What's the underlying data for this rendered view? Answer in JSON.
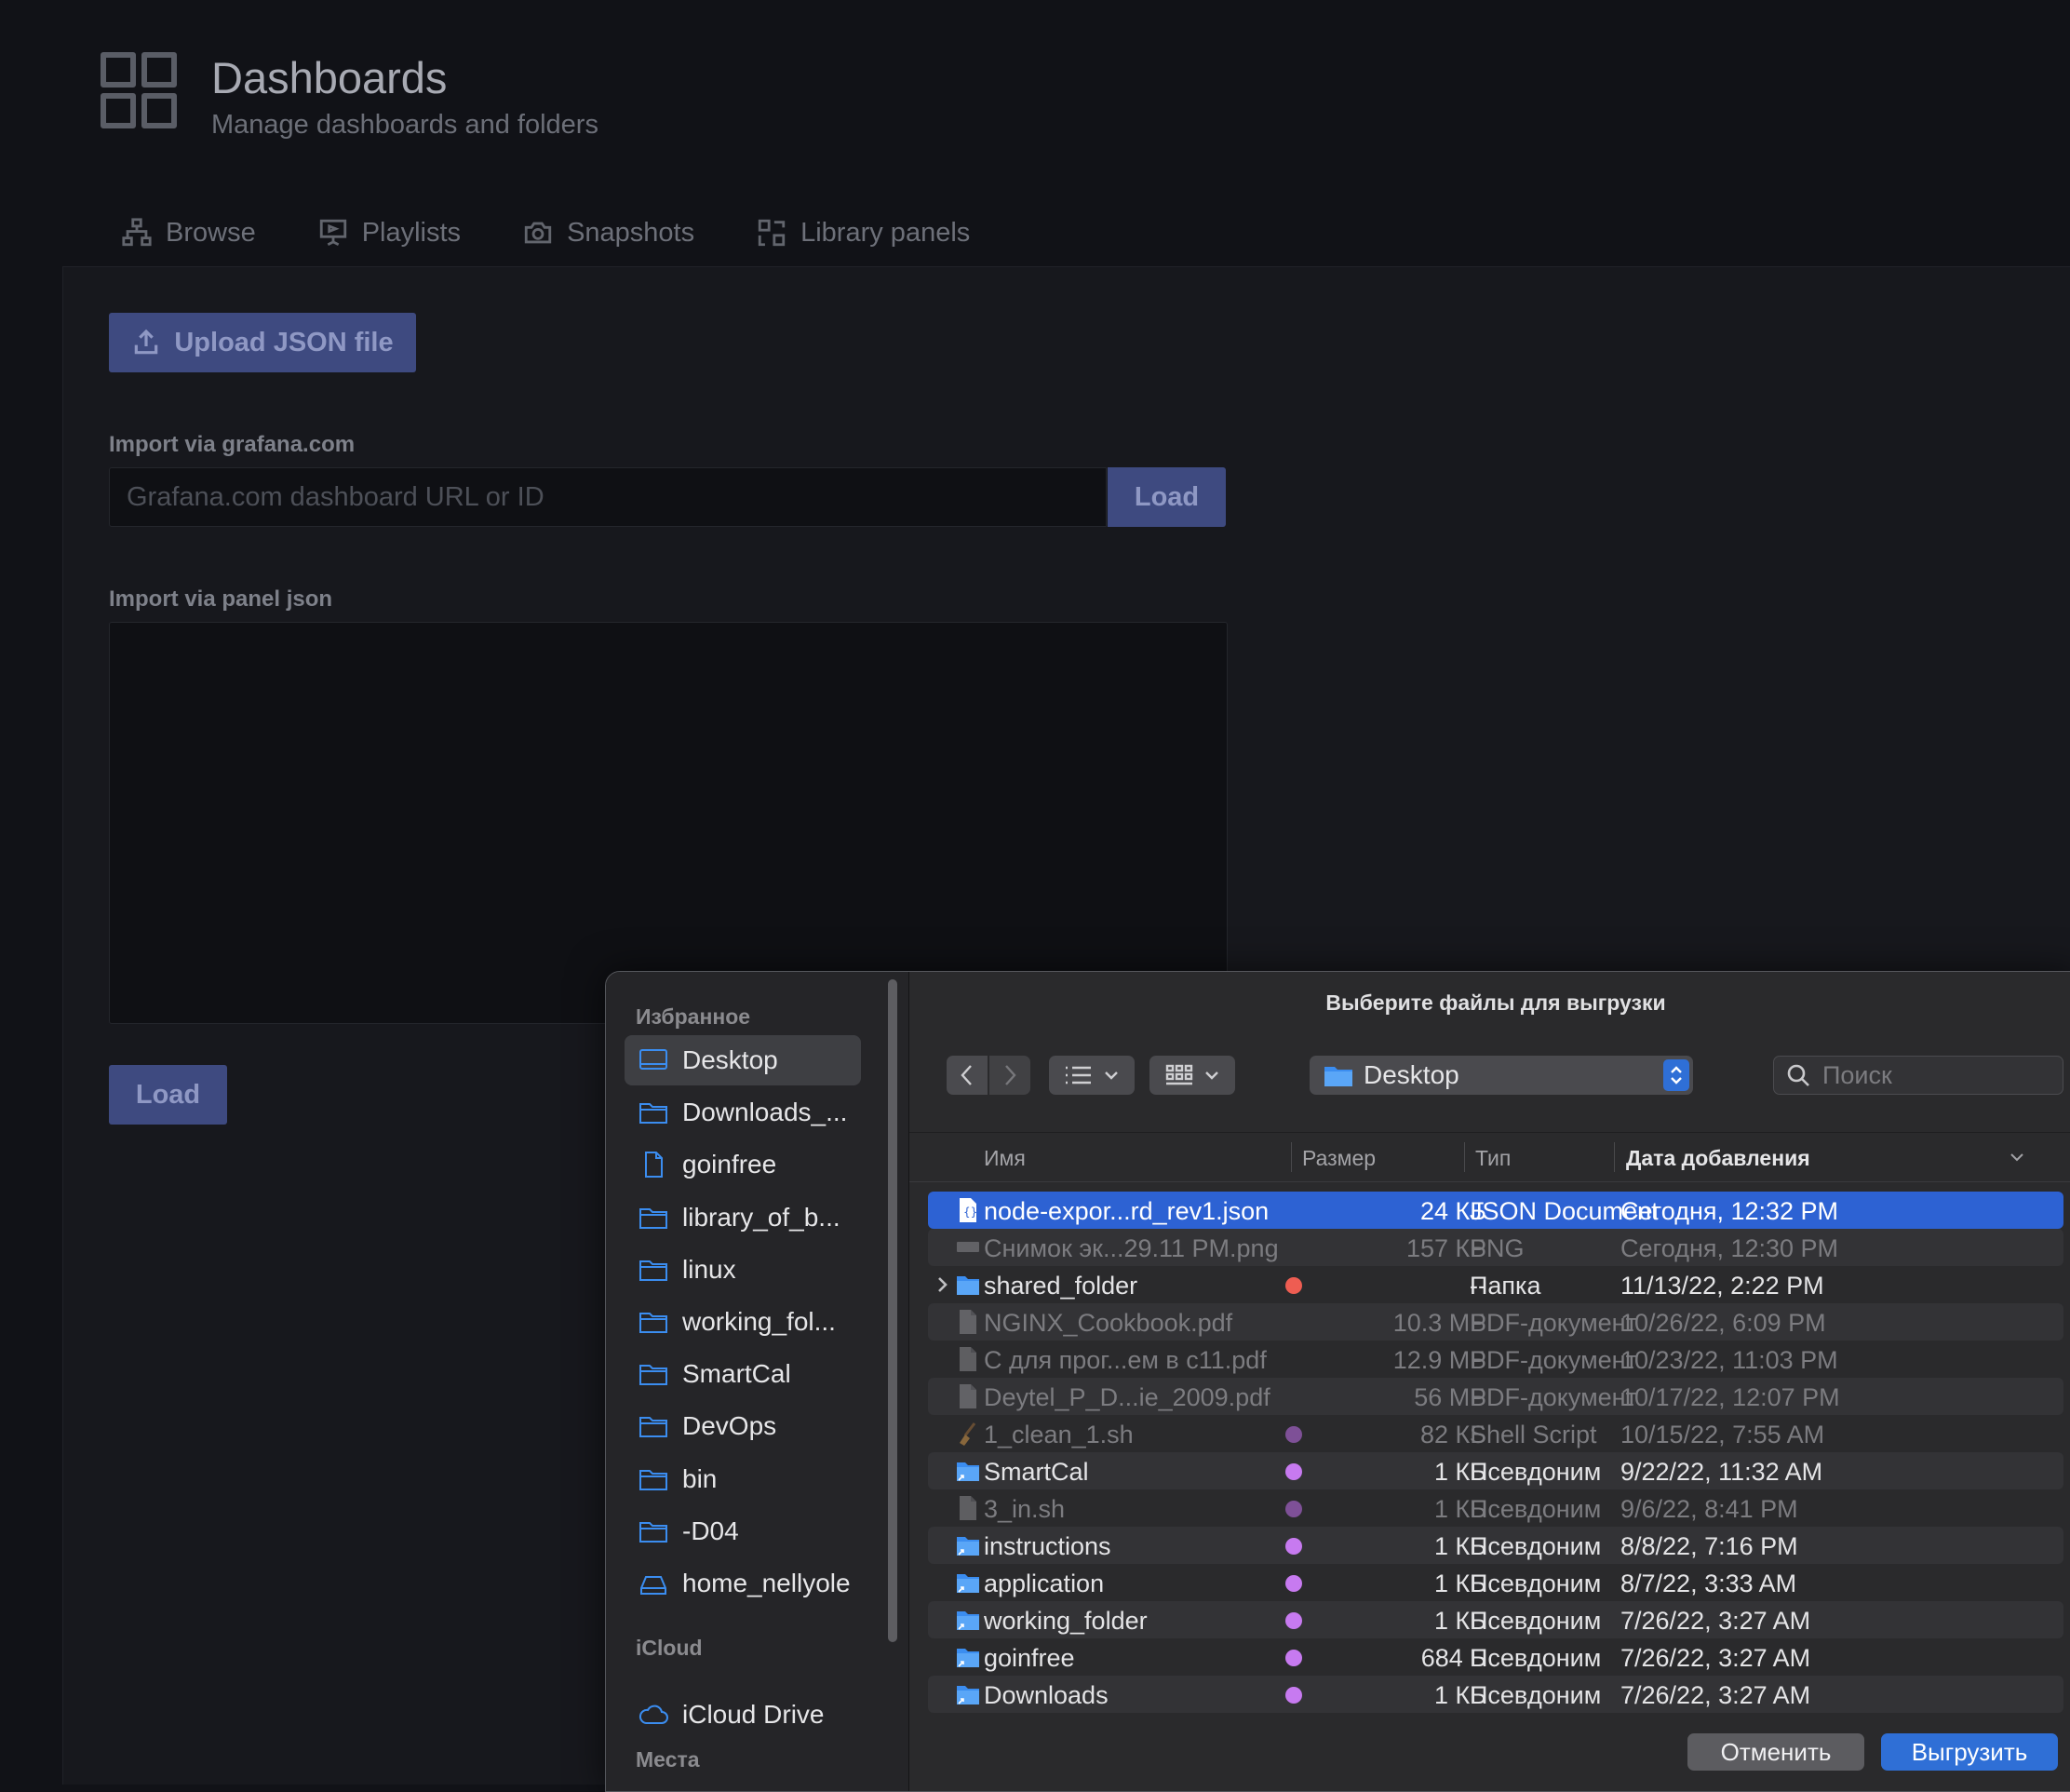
{
  "header": {
    "title": "Dashboards",
    "subtitle": "Manage dashboards and folders"
  },
  "tabs": [
    {
      "label": "Browse",
      "icon": "sitemap-icon"
    },
    {
      "label": "Playlists",
      "icon": "presentation-icon"
    },
    {
      "label": "Snapshots",
      "icon": "camera-icon"
    },
    {
      "label": "Library panels",
      "icon": "library-panels-icon"
    }
  ],
  "import": {
    "upload_label": "Upload JSON file",
    "grafana_label": "Import via grafana.com",
    "grafana_placeholder": "Grafana.com dashboard URL or ID",
    "load_label": "Load",
    "panel_json_label": "Import via panel json",
    "load_bottom_label": "Load"
  },
  "dialog": {
    "title": "Выберите файлы для выгрузки",
    "sidebar": {
      "favorites_label": "Избранное",
      "items": [
        {
          "label": "Desktop",
          "icon": "desktop-icon"
        },
        {
          "label": "Downloads_...",
          "icon": "folder-icon"
        },
        {
          "label": "goinfree",
          "icon": "document-icon"
        },
        {
          "label": "library_of_b...",
          "icon": "folder-icon"
        },
        {
          "label": "linux",
          "icon": "folder-icon"
        },
        {
          "label": "working_fol...",
          "icon": "folder-icon"
        },
        {
          "label": "SmartCal",
          "icon": "folder-icon"
        },
        {
          "label": "DevOps",
          "icon": "folder-icon"
        },
        {
          "label": "bin",
          "icon": "folder-icon"
        },
        {
          "label": "-D04",
          "icon": "folder-icon"
        },
        {
          "label": "home_nellyole",
          "icon": "drive-icon"
        }
      ],
      "icloud_label": "iCloud",
      "icloud_item": "iCloud Drive",
      "places_label": "Места"
    },
    "path": "Desktop",
    "search_placeholder": "Поиск",
    "columns": {
      "name": "Имя",
      "size": "Размер",
      "type": "Тип",
      "date": "Дата добавления"
    },
    "files": [
      {
        "name": "node-expor...rd_rev1.json",
        "size": "24 КБ",
        "type": "JSON Document",
        "date": "Сегодня, 12:32 PM",
        "icon": "json-file-icon",
        "tag": "",
        "selected": true,
        "dim": false,
        "folder": false
      },
      {
        "name": "Снимок эк...29.11 PM.png",
        "size": "157 КБ",
        "type": "PNG",
        "date": "Сегодня, 12:30 PM",
        "icon": "image-file-icon",
        "tag": "",
        "selected": false,
        "dim": true,
        "folder": false
      },
      {
        "name": "shared_folder",
        "size": "--",
        "type": "Папка",
        "date": "11/13/22, 2:22 PM",
        "icon": "folder-icon",
        "tag": "#ee5d52",
        "selected": false,
        "dim": false,
        "folder": true,
        "expandable": true
      },
      {
        "name": "NGINX_Cookbook.pdf",
        "size": "10.3 МБ",
        "type": "PDF-документ",
        "date": "10/26/22, 6:09 PM",
        "icon": "pdf-file-icon",
        "tag": "",
        "selected": false,
        "dim": true,
        "folder": false
      },
      {
        "name": "С для прог...ем в c11.pdf",
        "size": "12.9 МБ",
        "type": "PDF-документ",
        "date": "10/23/22, 11:03 PM",
        "icon": "pdf-file-icon",
        "tag": "",
        "selected": false,
        "dim": true,
        "folder": false
      },
      {
        "name": "Deytel_P_D...ie_2009.pdf",
        "size": "56 МБ",
        "type": "PDF-документ",
        "date": "10/17/22, 12:07 PM",
        "icon": "pdf-file-icon",
        "tag": "",
        "selected": false,
        "dim": true,
        "folder": false
      },
      {
        "name": "1_clean_1.sh",
        "size": "82 КБ",
        "type": "Shell Script",
        "date": "10/15/22, 7:55 AM",
        "icon": "broom-icon",
        "tag": "#b76be0",
        "selected": false,
        "dim": true,
        "folder": false
      },
      {
        "name": "SmartCal",
        "size": "1 КБ",
        "type": "Псевдоним",
        "date": "9/22/22, 11:32 AM",
        "icon": "folder-alias-icon",
        "tag": "#c77af0",
        "selected": false,
        "dim": false,
        "folder": true
      },
      {
        "name": "3_in.sh",
        "size": "1 КБ",
        "type": "Псевдоним",
        "date": "9/6/22, 8:41 PM",
        "icon": "script-alias-icon",
        "tag": "#b76be0",
        "selected": false,
        "dim": true,
        "folder": false
      },
      {
        "name": "instructions",
        "size": "1 КБ",
        "type": "Псевдоним",
        "date": "8/8/22, 7:16 PM",
        "icon": "folder-alias-icon",
        "tag": "#c77af0",
        "selected": false,
        "dim": false,
        "folder": true
      },
      {
        "name": "application",
        "size": "1 КБ",
        "type": "Псевдоним",
        "date": "8/7/22, 3:33 AM",
        "icon": "folder-alias-icon",
        "tag": "#c77af0",
        "selected": false,
        "dim": false,
        "folder": true
      },
      {
        "name": "working_folder",
        "size": "1 КБ",
        "type": "Псевдоним",
        "date": "7/26/22, 3:27 AM",
        "icon": "folder-alias-icon",
        "tag": "#c77af0",
        "selected": false,
        "dim": false,
        "folder": true
      },
      {
        "name": "goinfree",
        "size": "684 Б",
        "type": "Псевдоним",
        "date": "7/26/22, 3:27 AM",
        "icon": "folder-alias-icon",
        "tag": "#c77af0",
        "selected": false,
        "dim": false,
        "folder": true
      },
      {
        "name": "Downloads",
        "size": "1 КБ",
        "type": "Псевдоним",
        "date": "7/26/22, 3:27 AM",
        "icon": "folder-alias-icon",
        "tag": "#c77af0",
        "selected": false,
        "dim": false,
        "folder": true
      }
    ],
    "cancel_label": "Отменить",
    "upload_label": "Выгрузить"
  },
  "colors": {
    "selection": "#2d62d3",
    "accent_blue": "#2f6fd6",
    "grafana_button": "#3e4a80"
  }
}
